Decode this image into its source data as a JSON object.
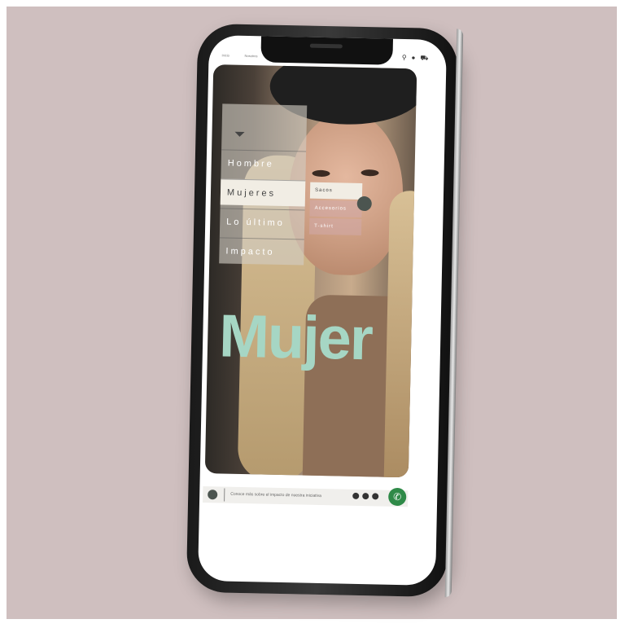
{
  "topbar": {
    "nav_left": [
      "Inicio",
      "Nosotros"
    ],
    "icons": [
      "search-icon",
      "user-icon",
      "cart-icon"
    ]
  },
  "menu": {
    "items": [
      {
        "label": "Hombre"
      },
      {
        "label": "Mujeres"
      },
      {
        "label": "Lo último"
      },
      {
        "label": "Impacto"
      }
    ],
    "submenu": [
      "Sacos",
      "Accesorios",
      "T-shirt"
    ]
  },
  "hero": {
    "title": "Mujer"
  },
  "footer": {
    "text": "Conoce más sobre el impacto de nuestra iniciativa",
    "social_icons": [
      "instagram-icon",
      "facebook-icon",
      "tiktok-icon"
    ],
    "whatsapp_icon": "whatsapp-icon"
  },
  "colors": {
    "background": "#cfbfbf",
    "title": "#a6d6c4",
    "whatsapp": "#2f8a48"
  }
}
